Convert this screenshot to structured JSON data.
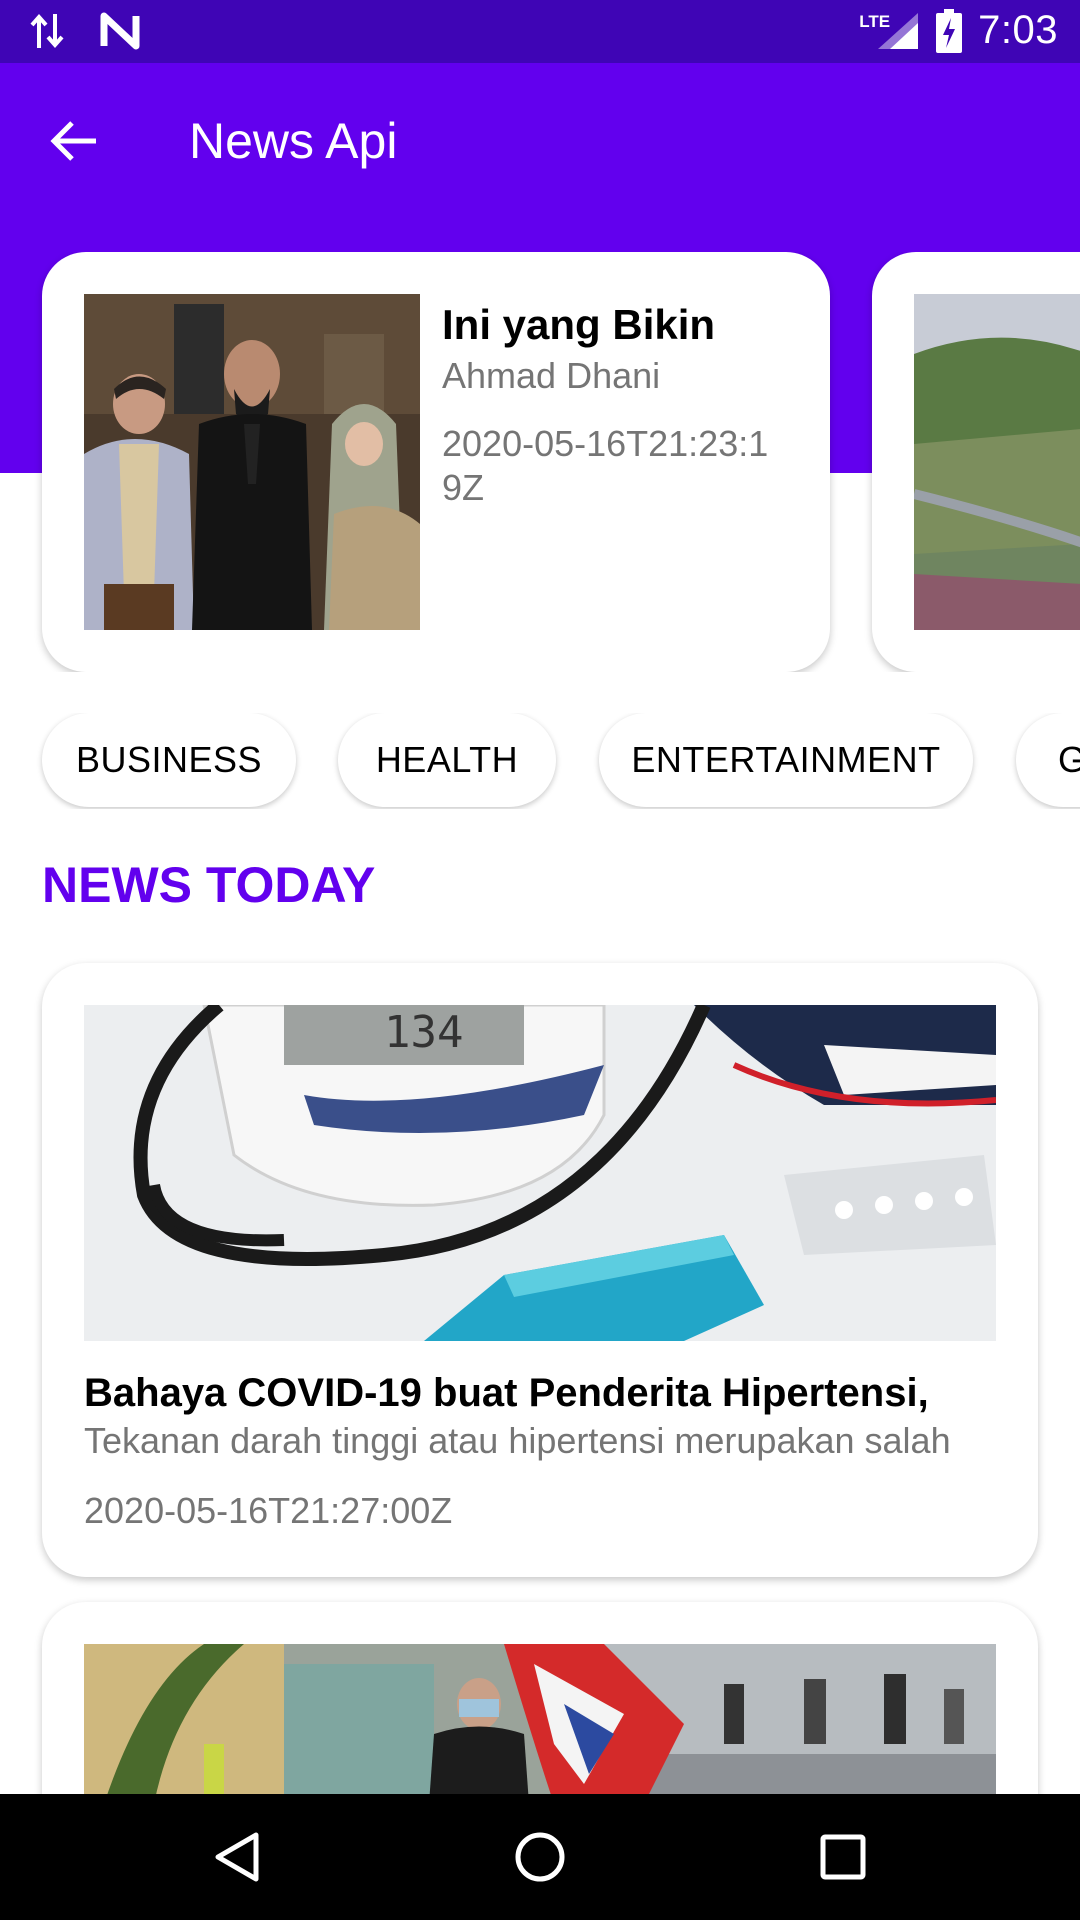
{
  "status_bar": {
    "time": "7:03",
    "network": "LTE"
  },
  "toolbar": {
    "title": "News Api"
  },
  "featured": [
    {
      "title": "Ini yang Bikin",
      "author": "Ahmad Dhani",
      "date": "2020-05-16T21:23:19Z"
    }
  ],
  "categories": [
    "BUSINESS",
    "HEALTH",
    "ENTERTAINMENT",
    "GENERAL"
  ],
  "section": {
    "title": "NEWS TODAY"
  },
  "news": [
    {
      "title": "Bahaya COVID-19 buat Penderita Hipertensi,",
      "description": "Tekanan darah tinggi atau hipertensi merupakan salah",
      "date": "2020-05-16T21:27:00Z"
    }
  ],
  "colors": {
    "primary": "#6200ee",
    "status_bar": "#3f05b5",
    "secondary_text": "#757575"
  }
}
